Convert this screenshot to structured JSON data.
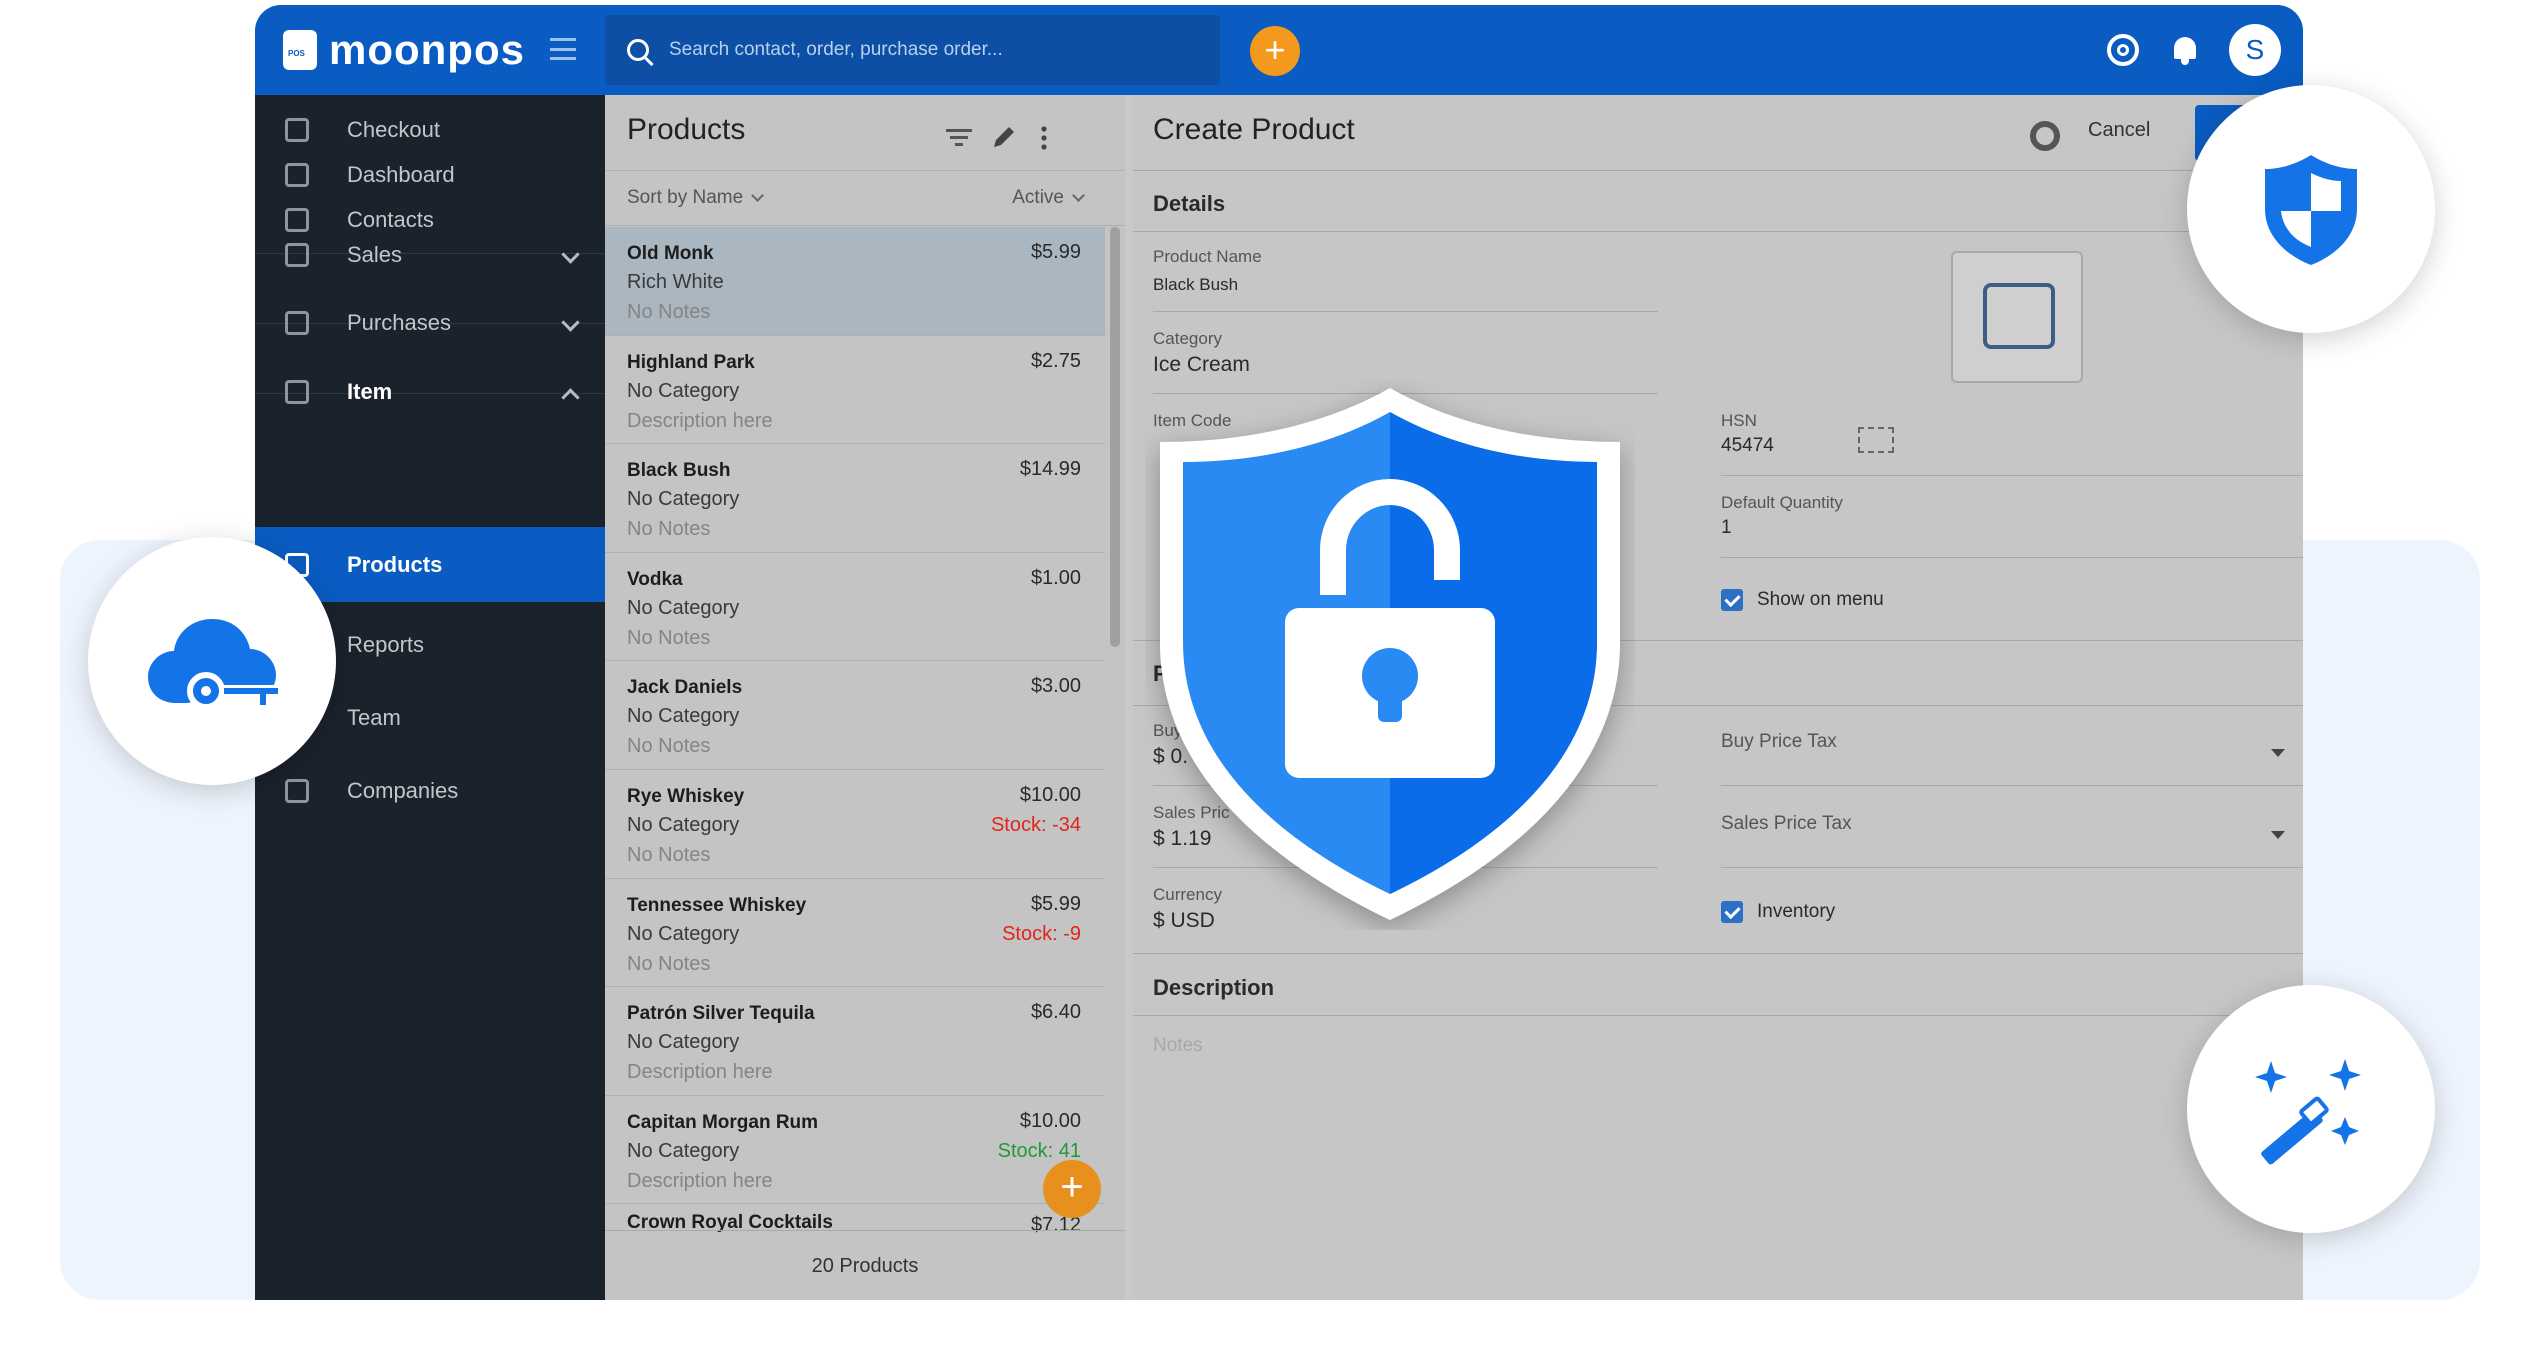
{
  "app": {
    "brand": "moonpos",
    "search_placeholder": "Search contact, order, purchase order...",
    "avatar_initial": "S"
  },
  "sidebar": {
    "items": [
      {
        "label": "Checkout"
      },
      {
        "label": "Dashboard"
      },
      {
        "label": "Contacts"
      },
      {
        "label": "Sales"
      },
      {
        "label": "Purchases"
      },
      {
        "label": "Item"
      },
      {
        "label": "Products"
      },
      {
        "label": "Reports"
      },
      {
        "label": "Team"
      },
      {
        "label": "Companies"
      }
    ]
  },
  "products": {
    "title": "Products",
    "sort_label": "Sort by Name",
    "filter_label": "Active",
    "footer": "20 Products",
    "rows": [
      {
        "name": "Old Monk",
        "price": "$5.99",
        "category": "Rich White",
        "notes": "No Notes",
        "stock": ""
      },
      {
        "name": "Highland Park",
        "price": "$2.75",
        "category": "No Category",
        "notes": "Description here",
        "stock": ""
      },
      {
        "name": "Black Bush",
        "price": "$14.99",
        "category": "No Category",
        "notes": "No Notes",
        "stock": ""
      },
      {
        "name": "Vodka",
        "price": "$1.00",
        "category": "No Category",
        "notes": "No Notes",
        "stock": ""
      },
      {
        "name": "Jack Daniels",
        "price": "$3.00",
        "category": "No Category",
        "notes": "No Notes",
        "stock": ""
      },
      {
        "name": "Rye Whiskey",
        "price": "$10.00",
        "category": "No Category",
        "notes": "No Notes",
        "stock": "Stock:  -34"
      },
      {
        "name": "Tennessee Whiskey",
        "price": "$5.99",
        "category": "No Category",
        "notes": "No Notes",
        "stock": "Stock:  -9"
      },
      {
        "name": "Patrón Silver Tequila",
        "price": "$6.40",
        "category": "No Category",
        "notes": "Description here",
        "stock": ""
      },
      {
        "name": "Capitan Morgan Rum",
        "price": "$10.00",
        "category": "No Category",
        "notes": "Description here",
        "stock": "Stock:  41"
      },
      {
        "name": "Crown Royal Cocktails",
        "price": "$7.12",
        "category": "",
        "notes": "",
        "stock": ""
      }
    ]
  },
  "form": {
    "title": "Create Product",
    "cancel_label": "Cancel",
    "details_heading": "Details",
    "description_heading": "Description",
    "description_placeholder": "Notes",
    "product_name_label": "Product Name",
    "product_name_value": "Black Bush",
    "category_label": "Category",
    "category_value": "Ice Cream",
    "item_code_label": "Item Code",
    "hsn_label": "HSN",
    "hsn_value": "45474",
    "default_qty_label": "Default Quantity",
    "default_qty_value": "1",
    "show_on_menu_label": "Show on menu",
    "pricing_heading_fragment": "P",
    "buy_price_label_fragment": "Buy",
    "buy_price_value_fragment": "$  0.",
    "sales_price_label_fragment": "Sales Pric",
    "sales_price_value": "$  1.19",
    "buy_price_tax_label": "Buy Price Tax",
    "sales_price_tax_label": "Sales Price Tax",
    "currency_label": "Currency",
    "currency_value": "$ USD",
    "inventory_label": "Inventory"
  },
  "colors": {
    "brand_blue": "#0a5cc2",
    "sidebar_bg": "#1a222c",
    "accent_orange": "#f39a1e",
    "stock_negative": "#e0261b",
    "stock_positive": "#1e9a3a",
    "shield_light": "#2a8af4",
    "shield_dark": "#0a6ce8"
  },
  "icons": [
    "search-icon",
    "add-icon",
    "gear-icon",
    "bell-icon",
    "shield-lock-icon",
    "shield-icon",
    "cloud-key-icon",
    "magic-wand-icon",
    "image-placeholder-icon",
    "barcode-icon"
  ]
}
